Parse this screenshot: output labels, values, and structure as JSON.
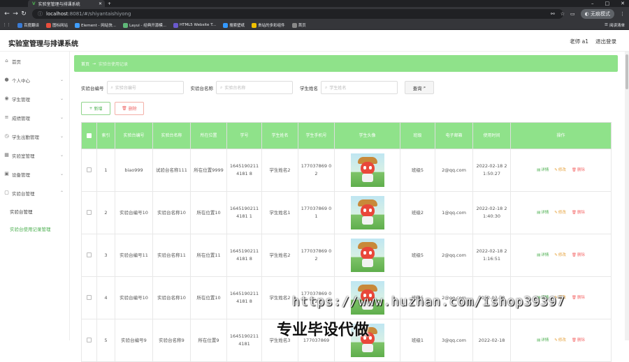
{
  "browser": {
    "tab_title": "实验室管理与排课系统",
    "url_host": "localhost",
    "url_path": ":8081/#/shiyantaishiyong",
    "incognito_label": "无痕模式",
    "bookmarks": [
      {
        "label": "百度翻译",
        "color": "#3a7bd5"
      },
      {
        "label": "图标网站",
        "color": "#e94e3c"
      },
      {
        "label": "Element - 网站快...",
        "color": "#409eff"
      },
      {
        "label": "Layui - 经典开源模...",
        "color": "#5fb878"
      },
      {
        "label": "HTML5 Website T...",
        "color": "#6a5acd"
      },
      {
        "label": "搜索壁纸",
        "color": "#3399ff"
      },
      {
        "label": "贵站的多彩组件",
        "color": "#f0c000"
      },
      {
        "label": "首页",
        "color": "#888888"
      }
    ],
    "reading_list": "阅读清单"
  },
  "header": {
    "title": "实验室管理与排课系统",
    "user": "老师 a1",
    "logout": "退出登录"
  },
  "sidebar": {
    "items": [
      {
        "label": "首页",
        "icon": "home-icon",
        "glyph": "⌂",
        "arrow": ""
      },
      {
        "label": "个人中心",
        "icon": "user-icon",
        "glyph": "●",
        "arrow": "⌄"
      },
      {
        "label": "学生管理",
        "icon": "student-icon",
        "glyph": "◉",
        "arrow": "⌄"
      },
      {
        "label": "成绩管理",
        "icon": "grade-icon",
        "glyph": "≡",
        "arrow": "⌄"
      },
      {
        "label": "学生出勤管理",
        "icon": "attendance-icon",
        "glyph": "◷",
        "arrow": "⌄"
      },
      {
        "label": "实验室管理",
        "icon": "lab-icon",
        "glyph": "▦",
        "arrow": "⌄"
      },
      {
        "label": "设备管理",
        "icon": "device-icon",
        "glyph": "▣",
        "arrow": "⌄"
      },
      {
        "label": "实验台管理",
        "icon": "bench-icon",
        "glyph": "▢",
        "arrow": "⌃"
      }
    ],
    "subitems": [
      {
        "label": "实验台管理",
        "active": false
      },
      {
        "label": "实验台使用记录管理",
        "active": true
      }
    ]
  },
  "breadcrumb": {
    "home": "首页",
    "sep": "→",
    "current": "实验台使用记录"
  },
  "search": {
    "fields": [
      {
        "label": "实验台编号",
        "placeholder": "实验台编号"
      },
      {
        "label": "实验台名称",
        "placeholder": "实验台名称"
      },
      {
        "label": "学生姓名",
        "placeholder": "学生姓名"
      }
    ],
    "button": "查询"
  },
  "actions": {
    "add": "新增",
    "delete": "删除"
  },
  "table": {
    "headers": [
      "索引",
      "实验台编号",
      "实验台名称",
      "所在位置",
      "学号",
      "学生姓名",
      "学生手机号",
      "学生头像",
      "班级",
      "电子邮箱",
      "使用时间",
      "操作"
    ],
    "ops": {
      "detail": "详情",
      "edit": "修改",
      "delete": "删除"
    },
    "rows": [
      {
        "index": "1",
        "bench_no": "biao999",
        "bench_name": "试验台名称111",
        "location": "所在位置9999",
        "student_no": "16451902114181 8",
        "name": "学生姓名2",
        "phone": "177037869 02",
        "class": "班级5",
        "email": "2@qq.com",
        "time": "2022-02-18 21:50:27"
      },
      {
        "index": "2",
        "bench_no": "实验台编号10",
        "bench_name": "实验台名称10",
        "location": "所在位置10",
        "student_no": "16451902114181 1",
        "name": "学生姓名1",
        "phone": "177037869 01",
        "class": "班级2",
        "email": "1@qq.com",
        "time": "2022-02-18 21:40:30"
      },
      {
        "index": "3",
        "bench_no": "实验台编号11",
        "bench_name": "实验台名称11",
        "location": "所在位置11",
        "student_no": "16451902114181 8",
        "name": "学生姓名2",
        "phone": "177037869 02",
        "class": "班级5",
        "email": "2@qq.com",
        "time": "2022-02-18 21:16:51"
      },
      {
        "index": "4",
        "bench_no": "实验台编号10",
        "bench_name": "实验台名称10",
        "location": "所在位置10",
        "student_no": "16451902114181 8",
        "name": "学生姓名2",
        "phone": "177037869 02",
        "class": "班级5",
        "email": "2@qq.com",
        "time": "2022-02-18"
      },
      {
        "index": "5",
        "bench_no": "实验台编号9",
        "bench_name": "实验台名称9",
        "location": "所在位置9",
        "student_no": "16451902114181",
        "name": "学生姓名3",
        "phone": "177037869",
        "class": "班级1",
        "email": "3@qq.com",
        "time": "2022-02-18"
      }
    ]
  },
  "watermark": {
    "url": "https://www.huzhan.com/ishop39397",
    "text": "专业毕设代做"
  }
}
